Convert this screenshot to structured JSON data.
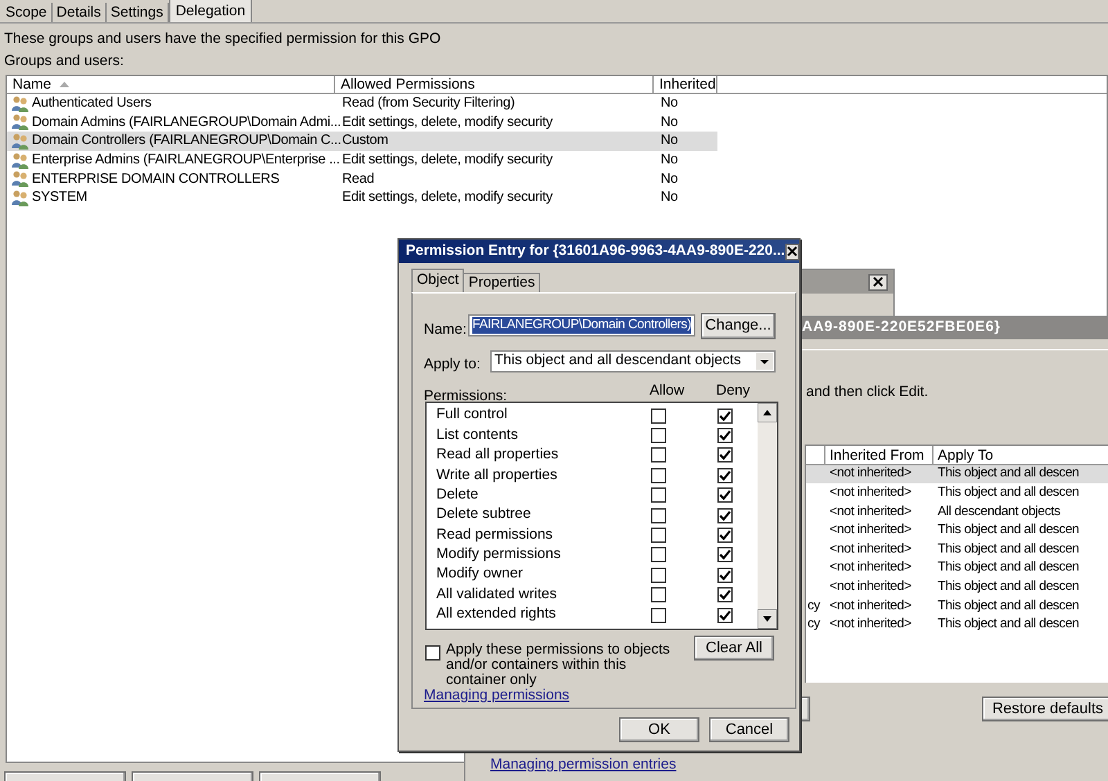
{
  "main": {
    "tabs": [
      {
        "label": "Scope",
        "selected": false
      },
      {
        "label": "Details",
        "selected": false
      },
      {
        "label": "Settings",
        "selected": false
      },
      {
        "label": "Delegation",
        "selected": true
      }
    ],
    "description": "These groups and users have the specified permission for this GPO",
    "list_label": "Groups and users:",
    "table": {
      "columns": [
        "Name",
        "Allowed Permissions",
        "Inherited"
      ],
      "rows": [
        {
          "name": "Authenticated Users",
          "permissions": "Read (from Security Filtering)",
          "inherited": "No",
          "selected": false
        },
        {
          "name": "Domain Admins (FAIRLANEGROUP\\Domain Admi...",
          "permissions": "Edit settings, delete, modify security",
          "inherited": "No",
          "selected": false
        },
        {
          "name": "Domain Controllers (FAIRLANEGROUP\\Domain C...",
          "permissions": "Custom",
          "inherited": "No",
          "selected": true
        },
        {
          "name": "Enterprise Admins (FAIRLANEGROUP\\Enterprise ...",
          "permissions": "Edit settings, delete, modify security",
          "inherited": "No",
          "selected": false
        },
        {
          "name": "ENTERPRISE DOMAIN CONTROLLERS",
          "permissions": "Read",
          "inherited": "No",
          "selected": false
        },
        {
          "name": "SYSTEM",
          "permissions": "Edit settings, delete, modify security",
          "inherited": "No",
          "selected": false
        }
      ]
    }
  },
  "advanced_dialog": {
    "title": "AA9-890E-220E52FBE0E6}",
    "instruction": "and then click Edit.",
    "table": {
      "columns": [
        "Inherited From",
        "Apply To"
      ],
      "rows": [
        {
          "inherited_from": "<not inherited>",
          "apply_to": "This object and all descen",
          "selected": true
        },
        {
          "inherited_from": "<not inherited>",
          "apply_to": "This object and all descen",
          "selected": false
        },
        {
          "inherited_from": "<not inherited>",
          "apply_to": "All descendant objects",
          "selected": false
        },
        {
          "inherited_from": "<not inherited>",
          "apply_to": "This object and all descen",
          "selected": false
        },
        {
          "inherited_from": "<not inherited>",
          "apply_to": "This object and all descen",
          "selected": false
        },
        {
          "inherited_from": "<not inherited>",
          "apply_to": "This object and all descen",
          "selected": false
        },
        {
          "inherited_from": "<not inherited>",
          "apply_to": "This object and all descen",
          "selected": false
        },
        {
          "column_1": "cy",
          "inherited_from": "<not inherited>",
          "apply_to": "This object and all descen",
          "selected": false
        },
        {
          "column_1": "cy",
          "inherited_from": "<not inherited>",
          "apply_to": "This object and all descen",
          "selected": false
        }
      ]
    },
    "restore_button": "Restore defaults",
    "link": "Managing permission entries"
  },
  "permission_entry": {
    "title": "Permission Entry for {31601A96-9963-4AA9-890E-220...",
    "tabs": [
      {
        "label": "Object",
        "selected": true
      },
      {
        "label": "Properties",
        "selected": false
      }
    ],
    "name_label": "Name:",
    "name_value": "FAIRLANEGROUP\\Domain Controllers)",
    "change_button": "Change...",
    "apply_label": "Apply to:",
    "apply_value": "This object and all descendant objects",
    "permissions_label": "Permissions:",
    "allow_header": "Allow",
    "deny_header": "Deny",
    "permissions": [
      {
        "name": "Full control",
        "allow": false,
        "deny": true
      },
      {
        "name": "List contents",
        "allow": false,
        "deny": true
      },
      {
        "name": "Read all properties",
        "allow": false,
        "deny": true
      },
      {
        "name": "Write all properties",
        "allow": false,
        "deny": true
      },
      {
        "name": "Delete",
        "allow": false,
        "deny": true
      },
      {
        "name": "Delete subtree",
        "allow": false,
        "deny": true
      },
      {
        "name": "Read permissions",
        "allow": false,
        "deny": true
      },
      {
        "name": "Modify permissions",
        "allow": false,
        "deny": true
      },
      {
        "name": "Modify owner",
        "allow": false,
        "deny": true
      },
      {
        "name": "All validated writes",
        "allow": false,
        "deny": true
      },
      {
        "name": "All extended rights",
        "allow": false,
        "deny": true
      }
    ],
    "apply_only": {
      "label": "Apply these permissions to objects and/or containers within this container only",
      "checked": false
    },
    "clear_button": "Clear All",
    "link": "Managing permissions",
    "ok_button": "OK",
    "cancel_button": "Cancel"
  }
}
